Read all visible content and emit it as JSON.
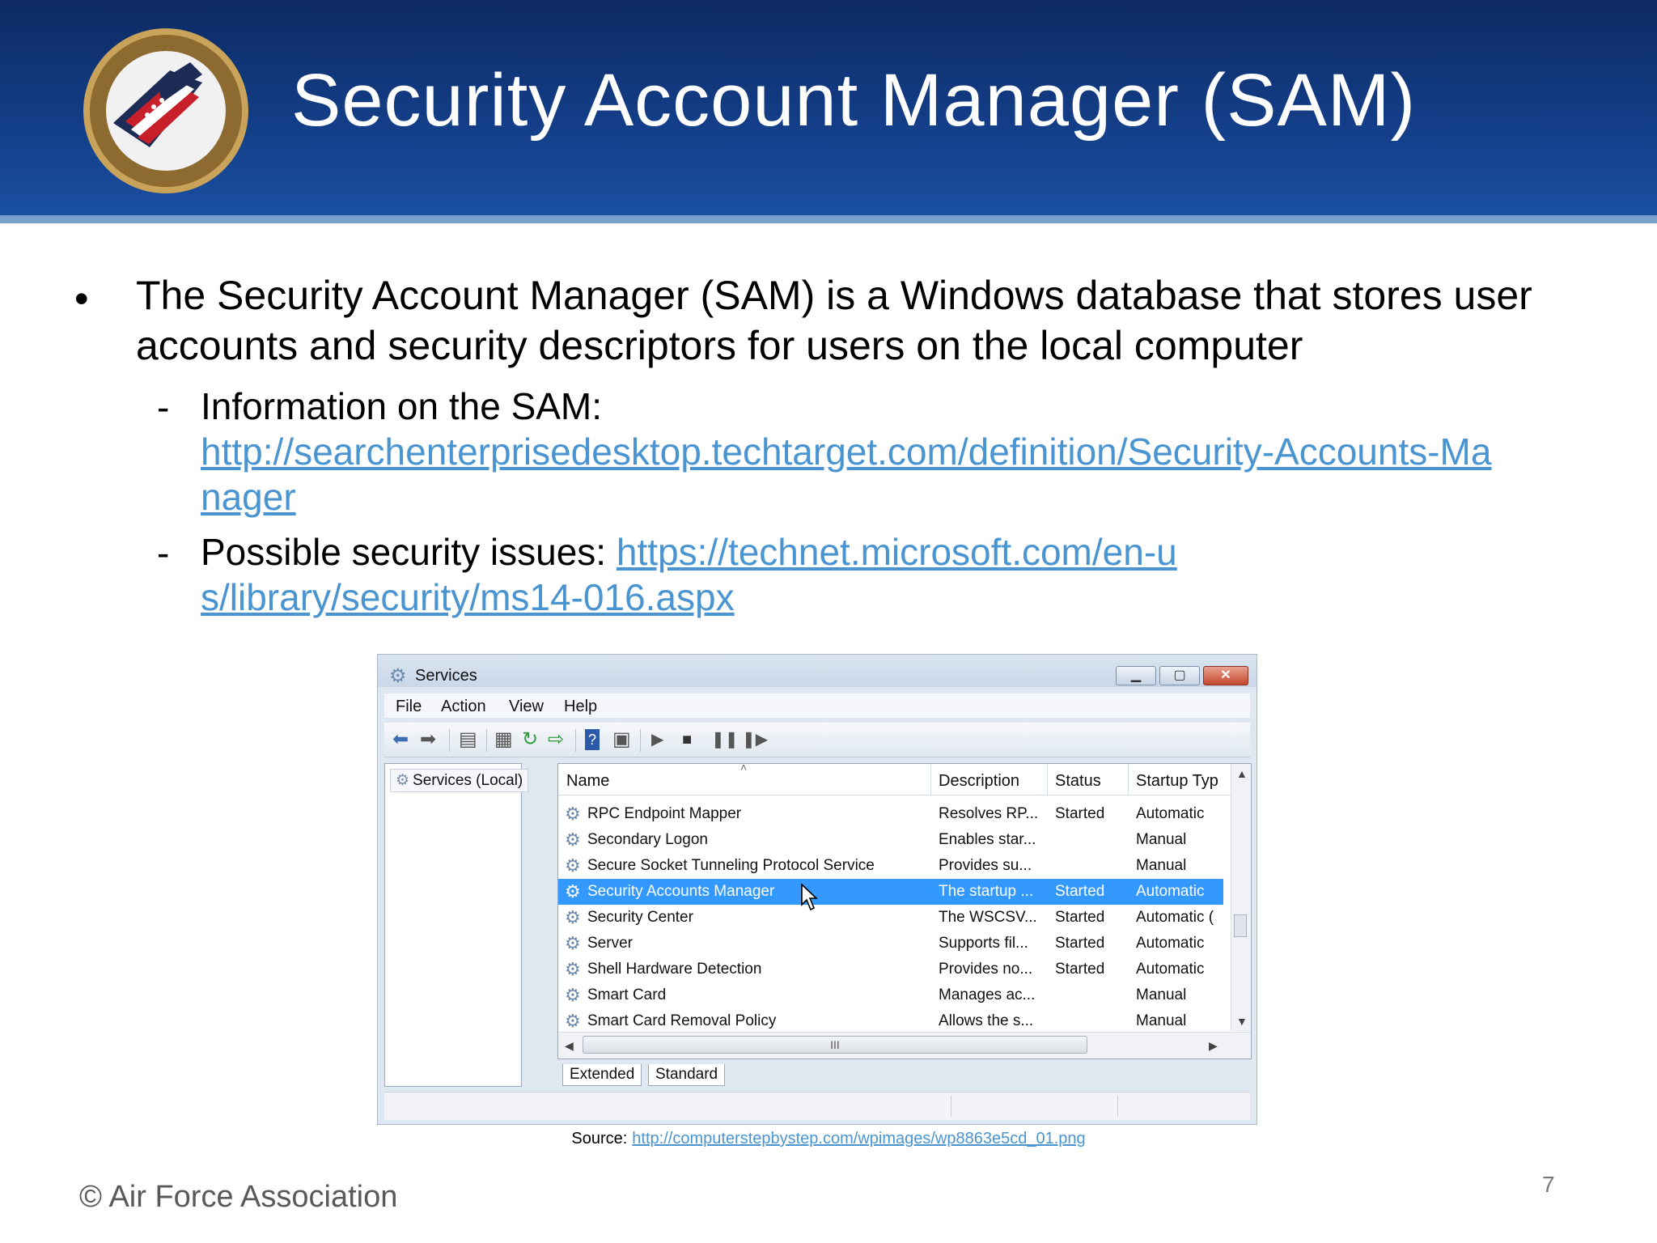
{
  "slide": {
    "title": "Security Account Manager (SAM)",
    "bullet_symbol": "•",
    "bullet_text": "The Security Account Manager (SAM) is a Windows database that stores user accounts and security descriptors for users on the local computer",
    "sub1_label": "Information on the SAM:",
    "sub1_link": "http://searchenterprisedesktop.techtarget.com/definition/Security-Accounts-Manager",
    "sub2_label": "Possible security issues:",
    "sub2_link": "https://technet.microsoft.com/en-us/library/security/ms14-016.aspx",
    "dash": "-",
    "footer": "© Air Force Association",
    "page_number": "7",
    "source_label": "Source:",
    "source_link": "http://computerstepbystep.com/wpimages/wp8863e5cd_01.png"
  },
  "window": {
    "title": "Services",
    "menu": [
      "File",
      "Action",
      "View",
      "Help"
    ],
    "tree_item": "Services (Local)",
    "columns": [
      "Name",
      "Description",
      "Status",
      "Startup Typ"
    ],
    "rows": [
      {
        "name": "RPC Endpoint Mapper",
        "description": "Resolves RP...",
        "status": "Started",
        "startup": "Automatic"
      },
      {
        "name": "Secondary Logon",
        "description": "Enables star...",
        "status": "",
        "startup": "Manual"
      },
      {
        "name": "Secure Socket Tunneling Protocol Service",
        "description": "Provides su...",
        "status": "",
        "startup": "Manual"
      },
      {
        "name": "Security Accounts Manager",
        "description": "The startup ...",
        "status": "Started",
        "startup": "Automatic",
        "selected": true
      },
      {
        "name": "Security Center",
        "description": "The WSCSV...",
        "status": "Started",
        "startup": "Automatic ("
      },
      {
        "name": "Server",
        "description": "Supports fil...",
        "status": "Started",
        "startup": "Automatic"
      },
      {
        "name": "Shell Hardware Detection",
        "description": "Provides no...",
        "status": "Started",
        "startup": "Automatic"
      },
      {
        "name": "Smart Card",
        "description": "Manages ac...",
        "status": "",
        "startup": "Manual"
      },
      {
        "name": "Smart Card Removal Policy",
        "description": "Allows the s...",
        "status": "",
        "startup": "Manual"
      }
    ],
    "tabs": [
      "Extended",
      "Standard"
    ],
    "scroll_thumb": "III"
  },
  "colors": {
    "header_dark": "#0d2a63",
    "header_light": "#1a4fa0",
    "link": "#4a95d1",
    "selection": "#3399ff"
  },
  "icons": [
    "cyberpatriot-logo",
    "gear-icon",
    "back-arrow-icon",
    "forward-arrow-icon",
    "play-icon",
    "stop-icon",
    "pause-icon",
    "restart-icon",
    "help-icon",
    "mouse-cursor-icon"
  ]
}
